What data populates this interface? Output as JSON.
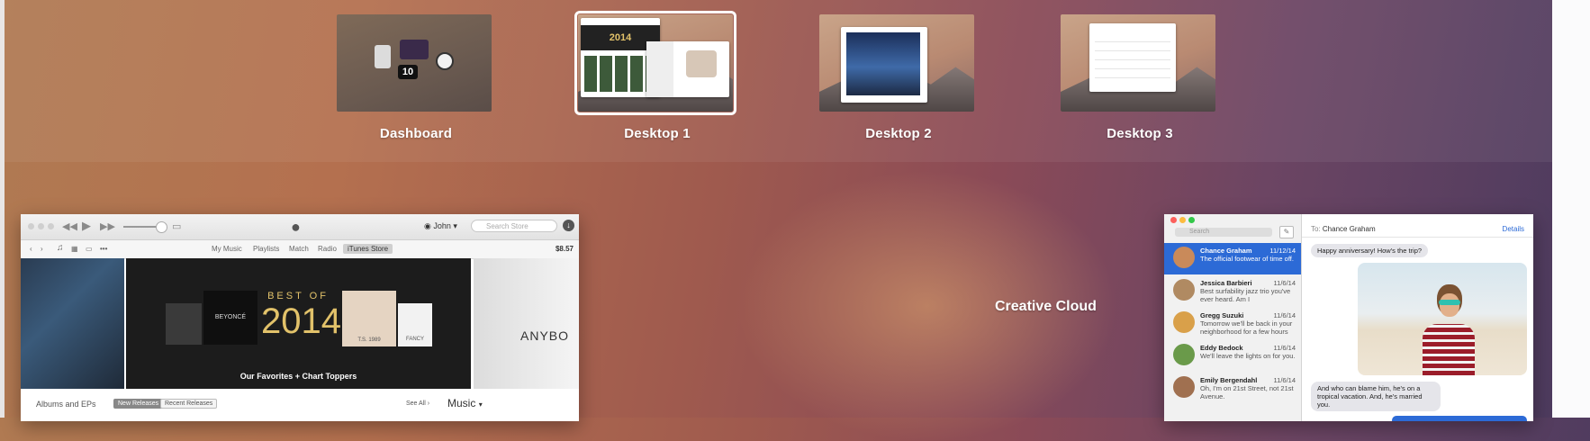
{
  "spaces": [
    {
      "label": "Dashboard"
    },
    {
      "label": "Desktop 1",
      "active": true
    },
    {
      "label": "Desktop 2"
    },
    {
      "label": "Desktop 3"
    }
  ],
  "dashboard_clock_number": "10",
  "desktop1_thumb_text": "2014",
  "itunes": {
    "user": "John",
    "search_placeholder": "Search Store",
    "nav_tabs": [
      "My Music",
      "Playlists",
      "Match",
      "Radio",
      "iTunes Store"
    ],
    "selected_tab": "iTunes Store",
    "balance": "$8.57",
    "banner": {
      "best_of": "BEST OF",
      "year": "2014",
      "caption": "Our Favorites + Chart Toppers",
      "album1": "BEYONCÉ",
      "album2": "T.S.  1989",
      "album3": "FANCY",
      "side_text": "ANYBO"
    },
    "albums_row": {
      "title": "Albums and EPs",
      "pill_new": "New Releases",
      "pill_recent": "Recent Releases",
      "see_all": "See All",
      "music_menu": "Music"
    }
  },
  "creative_cloud_label": "Creative Cloud",
  "messages": {
    "search_placeholder": "Search",
    "to_label": "To:",
    "to_name": "Chance Graham",
    "details": "Details",
    "conversations": [
      {
        "name": "Chance Graham",
        "date": "11/12/14",
        "preview": "The official footwear of time off.",
        "selected": true,
        "avatar_color": "#c98a5a"
      },
      {
        "name": "Jessica Barbieri",
        "date": "11/6/14",
        "preview": "Best surfability jazz trio you've ever heard. Am I",
        "avatar_color": "#b08a62"
      },
      {
        "name": "Gregg Suzuki",
        "date": "11/6/14",
        "preview": "Tomorrow we'll be back in your neighborhood for a few hours",
        "avatar_color": "#d9a04a"
      },
      {
        "name": "Eddy Bedock",
        "date": "11/6/14",
        "preview": "We'll leave the lights on for you.",
        "avatar_color": "#6a9a4a"
      },
      {
        "name": "Emily Bergendahl",
        "date": "11/6/14",
        "preview": "Oh, I'm on 21st Street, not 21st Avenue.",
        "avatar_color": "#a07050"
      }
    ],
    "bubble_top": "Happy anniversary! How's the trip?",
    "bubble_bottom": "And who can blame him, he's on a tropical vacation. And, he's married you."
  },
  "colors": {
    "selection_blue": "#2c6ad6",
    "itunes_banner_gold": "#e2c26a"
  }
}
